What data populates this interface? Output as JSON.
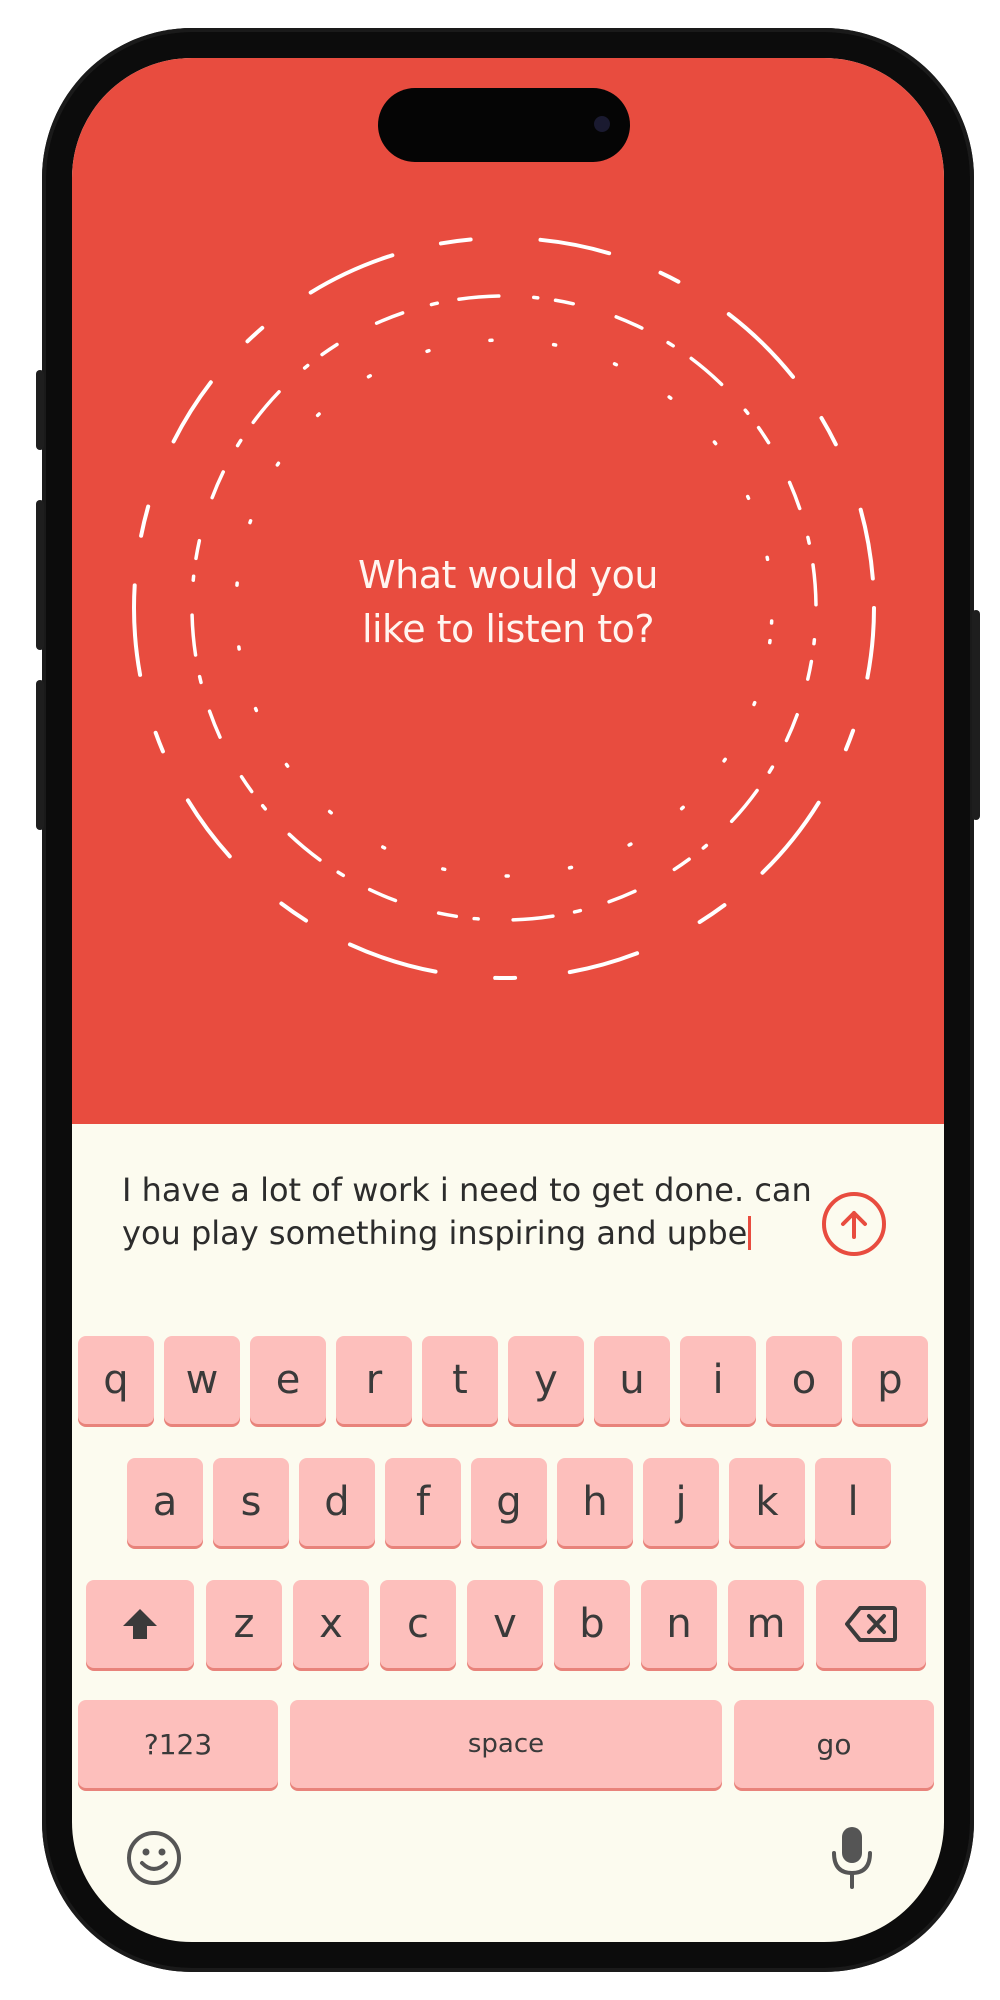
{
  "prompt": {
    "line1": "What would you",
    "line2": "like to listen to?"
  },
  "input": {
    "value": "I have a lot of work i need to get done. can you play something inspiring and upbe",
    "line1": "I have a lot of work i need to get done. can",
    "line2": "you play something inspiring and upbe"
  },
  "send_button": {
    "icon": "arrow-up-icon"
  },
  "keyboard": {
    "row1": [
      "q",
      "w",
      "e",
      "r",
      "t",
      "y",
      "u",
      "i",
      "o",
      "p"
    ],
    "row2": [
      "a",
      "s",
      "d",
      "f",
      "g",
      "h",
      "j",
      "k",
      "l"
    ],
    "row3": [
      "z",
      "x",
      "c",
      "v",
      "b",
      "n",
      "m"
    ],
    "shift_icon": "shift-icon",
    "backspace_icon": "backspace-icon",
    "numbers_label": "?123",
    "space_label": "space",
    "go_label": "go",
    "emoji_icon": "emoji-icon",
    "mic_icon": "microphone-icon"
  },
  "colors": {
    "accent": "#e84c3f",
    "background": "#fcfbef",
    "key": "#fdbfbc"
  }
}
